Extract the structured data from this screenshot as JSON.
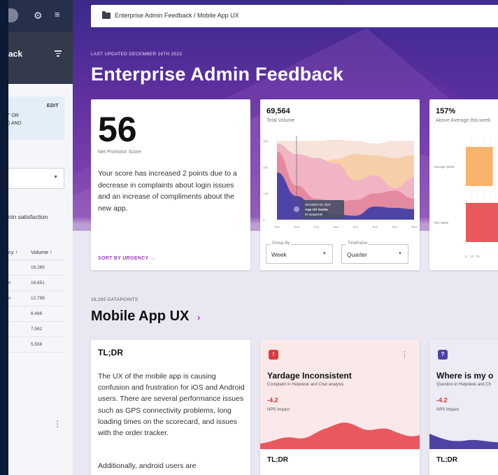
{
  "sidebar": {
    "title": "ack",
    "query_edit": "EDIT",
    "query_line1": "\" OR",
    "query_line2": ") AND",
    "satisfaction": "nin satisfaction",
    "table": {
      "col_urgency": "cy ↑",
      "col_volume": "Volume ↑",
      "rows": [
        {
          "urgency": "",
          "volume": "18,265"
        },
        {
          "urgency": "n",
          "volume": "16,651"
        },
        {
          "urgency": "n",
          "volume": "12,789"
        },
        {
          "urgency": "",
          "volume": "8,466"
        },
        {
          "urgency": "",
          "volume": "7,582"
        },
        {
          "urgency": "",
          "volume": "5,556"
        }
      ]
    }
  },
  "breadcrumb": "Enterprise Admin Feedback  /  Mobile App UX",
  "header": {
    "updated": "LAST UPDATED DECEMBER 16TH 2022",
    "title": "Enterprise Admin Feedback"
  },
  "nps": {
    "value": "56",
    "label": "Net Promotor Score",
    "description": "Your score has increased 2 points due to a decrease in complaints about login issues and an increase of compliments about the new app.",
    "sort_label": "SORT BY URGENCY  →"
  },
  "volume": {
    "value": "69,564",
    "label": "Total Volume",
    "group_by_label": "Group By",
    "group_by_value": "Week",
    "timeframe_label": "Timeframe",
    "timeframe_value": "Quarter"
  },
  "average": {
    "value": "157%",
    "label": "Above Average this week"
  },
  "section": {
    "datapoints": "18,265 DATAPOINTS",
    "title": "Mobile App UX",
    "chevron": "›"
  },
  "tldr": {
    "title": "TL;DR",
    "p1": "The UX of the mobile app is causing confusion and frustration for iOS and Android users. There are several performance issues such as GPS connectivity problems, long loading times on the scorecard, and issues with the order tracker.",
    "p2": "Additionally, android users are"
  },
  "issues": [
    {
      "badge": "!",
      "title": "Yardage Inconsistent",
      "subtitle": "Complaint in Helpdesk and Chat analysis",
      "delta": "-4.2",
      "impact": "NPS Impact",
      "tldr": "TL;DR"
    },
    {
      "badge": "?",
      "title": "Where is my o",
      "subtitle": "Question in Helpdesk and Ch",
      "delta": "-4.2",
      "impact": "NPS Impact",
      "tldr": "TL;DR"
    }
  ],
  "chart_data": [
    {
      "type": "area",
      "title": "",
      "x": [
        "Text",
        "Text",
        "Text",
        "Text",
        "Text",
        "Text",
        "Text",
        "Text"
      ],
      "yticks": [
        0,
        100,
        200,
        300
      ],
      "ylim": [
        0,
        320
      ],
      "series": [
        {
          "values": [
            300,
            300,
            300,
            305,
            300,
            290,
            300,
            300
          ],
          "color": "#f7e3d9"
        },
        {
          "values": [
            290,
            180,
            210,
            230,
            250,
            245,
            235,
            245
          ],
          "color": "#f6cfa9"
        },
        {
          "values": [
            290,
            250,
            235,
            215,
            150,
            170,
            120,
            160
          ],
          "color": "#f1b4c4"
        },
        {
          "values": [
            260,
            130,
            80,
            70,
            75,
            100,
            110,
            80
          ],
          "color": "#e48aa0"
        },
        {
          "values": [
            180,
            90,
            40,
            20,
            15,
            50,
            45,
            40
          ],
          "color": "#4e44a6"
        }
      ],
      "tooltip": {
        "date": "December 02, 2023",
        "name": "App UX Sucks",
        "count": "84 datapoints"
      }
    },
    {
      "type": "bar",
      "orientation": "horizontal",
      "categories": [
        "Average Week",
        "This Week"
      ],
      "values": [
        45,
        65
      ],
      "colors": [
        "#f7b46c",
        "#e8585d"
      ],
      "xticks": [
        "0",
        "10",
        "20"
      ]
    }
  ]
}
